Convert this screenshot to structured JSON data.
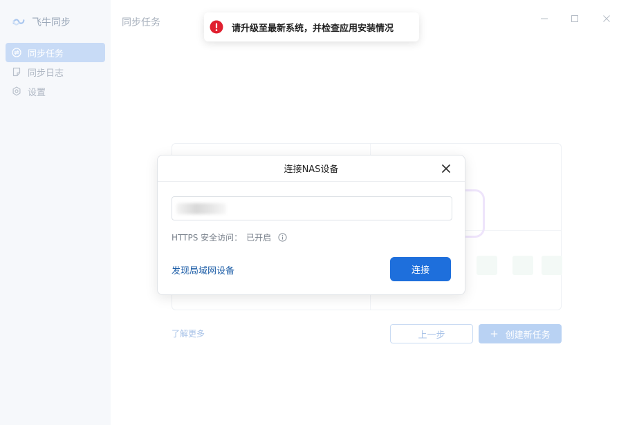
{
  "app": {
    "name": "飞牛同步"
  },
  "sidebar": {
    "items": [
      {
        "label": "同步任务",
        "icon": "sync-icon",
        "active": true
      },
      {
        "label": "同步日志",
        "icon": "log-icon",
        "active": false
      },
      {
        "label": "设置",
        "icon": "gear-icon",
        "active": false
      }
    ]
  },
  "header": {
    "title": "同步任务"
  },
  "toast": {
    "message": "请升级至最新系统，并检查应用安装情况",
    "icon": "error-icon",
    "color": "#e0202f"
  },
  "dialog": {
    "title": "连接NAS设备",
    "address_value": "",
    "https_label": "HTTPS 安全访问：",
    "https_value": "已开启",
    "discover_label": "发现局域网设备",
    "connect_label": "连接"
  },
  "footer": {
    "learn_more": "了解更多",
    "prev_label": "上一步",
    "create_label": "创建新任务"
  },
  "colors": {
    "accent": "#1e6fdc",
    "sidebar_active": "#c8dbf6",
    "link": "#1f5fa8"
  }
}
